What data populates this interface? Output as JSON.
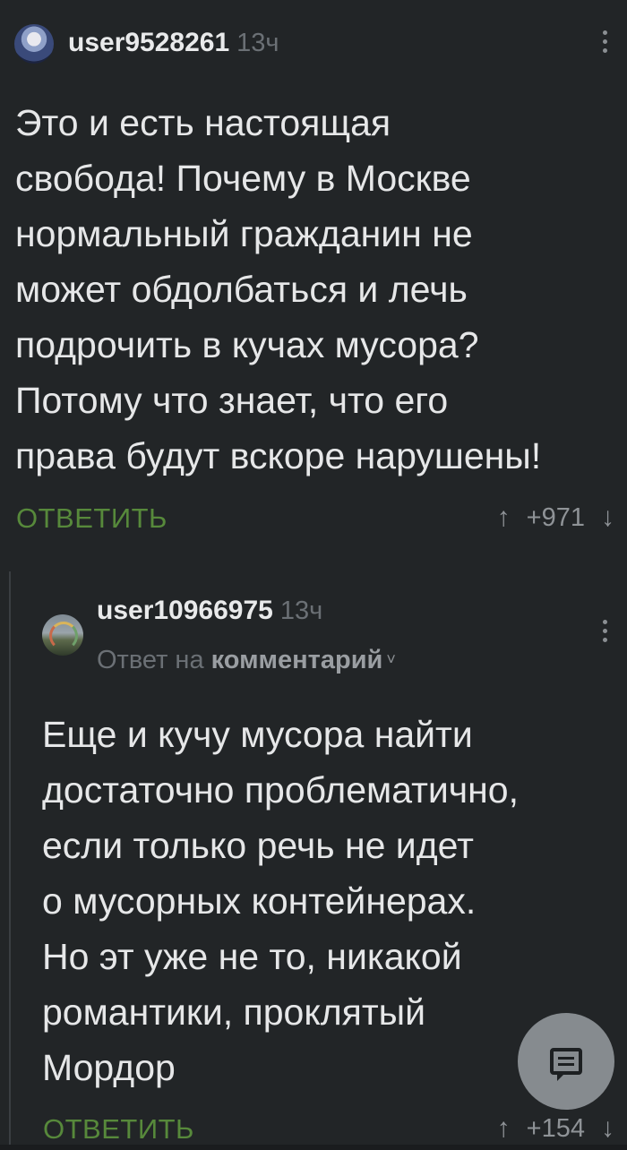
{
  "comments": [
    {
      "username": "user9528261",
      "time": "13ч",
      "lines": [
        "Это и есть настоящая",
        "свобода! Почему в Москве",
        "нормальный гражданин не",
        "может обдолбаться и лечь",
        "подрочить в кучах мусора?",
        "Потому что знает, что его",
        "права будут вскоре нарушены!"
      ],
      "reply_label": "ОТВЕТИТЬ",
      "rating": "+971",
      "upvote_icon": "↑",
      "downvote_icon": "↓"
    },
    {
      "username": "user10966975",
      "time": "13ч",
      "reply_to_prefix": "Ответ на",
      "reply_to_target": "комментарий",
      "reply_to_chevron": "˅",
      "lines": [
        "Еще и кучу мусора найти",
        "достаточно проблематично,",
        "если только речь не идет",
        "о мусорных контейнерах.",
        "Но эт уже не то, никакой",
        "романтики, проклятый",
        "Мордор"
      ],
      "reply_label": "ОТВЕТИТЬ",
      "rating": "+154",
      "upvote_icon": "↑",
      "downvote_icon": "↓"
    }
  ],
  "fab": {
    "icon": "comment-bubble-icon"
  },
  "colors": {
    "background": "#222527",
    "reply_green": "#57893b",
    "muted": "#6b7075",
    "text": "#e6e7e8"
  }
}
